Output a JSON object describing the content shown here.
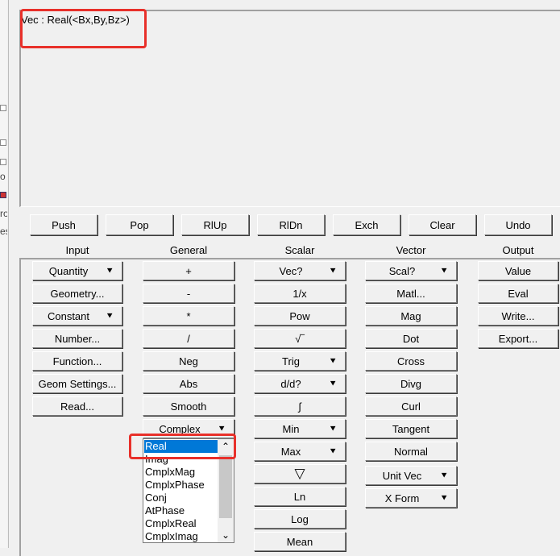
{
  "expression": "Vec : Real(<Bx,By,Bz>)",
  "edge_fragments": [
    "ro",
    "es"
  ],
  "stack_buttons": [
    "Push",
    "Pop",
    "RlUp",
    "RlDn",
    "Exch",
    "Clear",
    "Undo"
  ],
  "groups": {
    "input": {
      "label": "Input",
      "buttons": [
        "Quantity",
        "Geometry...",
        "Constant",
        "Number...",
        "Function...",
        "Geom Settings...",
        "Read..."
      ]
    },
    "general": {
      "label": "General",
      "buttons": [
        "+",
        "-",
        "*",
        "/",
        "Neg",
        "Abs",
        "Smooth",
        "Complex"
      ]
    },
    "scalar": {
      "label": "Scalar",
      "buttons": [
        "Vec?",
        "1/x",
        "Pow",
        "√‾",
        "Trig",
        "d/d?",
        "∫",
        "Min",
        "Max",
        "▽",
        "Ln",
        "Log",
        "Mean"
      ]
    },
    "vector": {
      "label": "Vector",
      "buttons": [
        "Scal?",
        "Matl...",
        "Mag",
        "Dot",
        "Cross",
        "Divg",
        "Curl",
        "Tangent",
        "Normal",
        "Unit Vec",
        "X Form"
      ]
    },
    "output": {
      "label": "Output",
      "buttons": [
        "Value",
        "Eval",
        "Write...",
        "Export..."
      ]
    }
  },
  "complex_dropdown": {
    "selected": "Real",
    "options": [
      "Real",
      "Imag",
      "CmplxMag",
      "CmplxPhase",
      "Conj",
      "AtPhase",
      "CmplxReal",
      "CmplxImag"
    ]
  },
  "icons": {
    "dropdown_arrow": "⯆",
    "scroll_up": "⌃",
    "scroll_down": "⌄"
  },
  "colors": {
    "highlight": "#e8302a",
    "selection": "#0078d7"
  }
}
